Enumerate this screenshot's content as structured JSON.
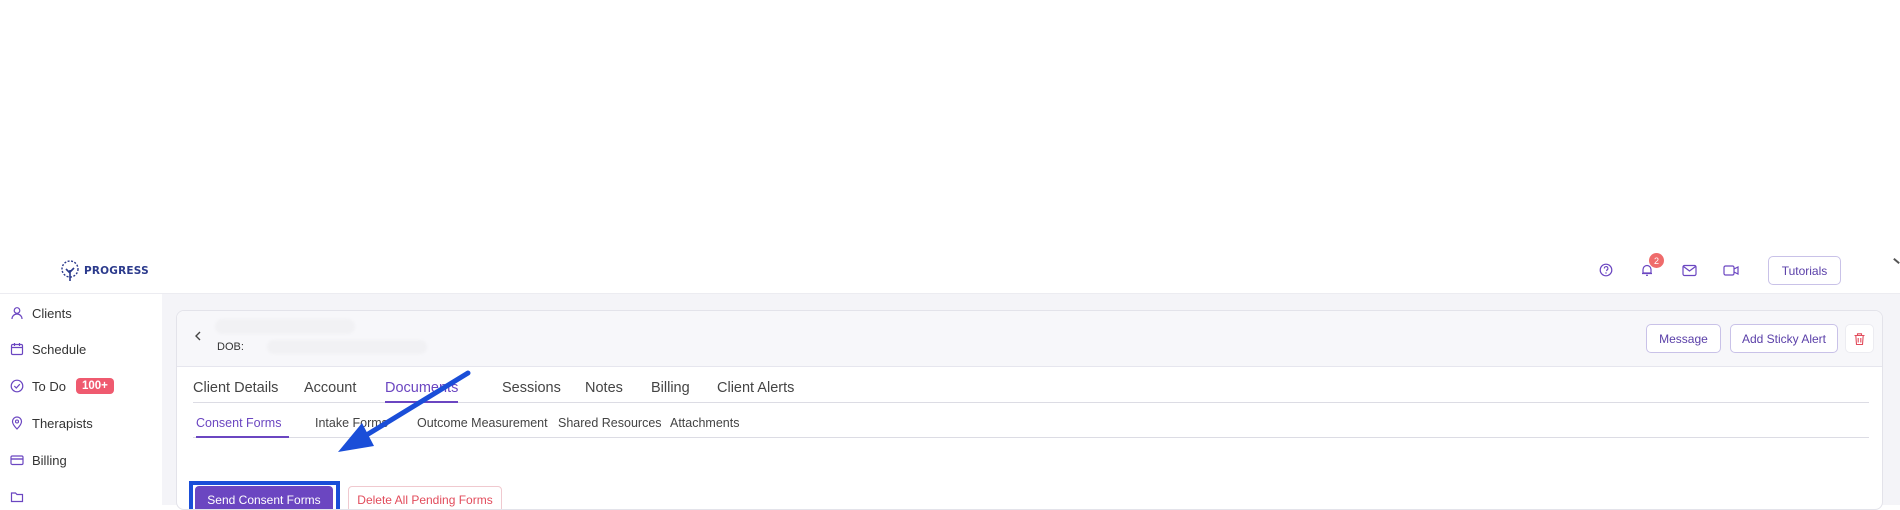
{
  "app": {
    "logo_text": "PROGRESS"
  },
  "topbar": {
    "icons": [
      "help-icon",
      "bell-icon",
      "mail-icon",
      "video-icon"
    ],
    "notification_count": "2",
    "tutorials_label": "Tutorials"
  },
  "sidebar": {
    "items": [
      {
        "label": "Clients",
        "icon": "user-icon"
      },
      {
        "label": "Schedule",
        "icon": "calendar-icon"
      },
      {
        "label": "To Do",
        "icon": "check-circle-icon",
        "badge": "100+"
      },
      {
        "label": "Therapists",
        "icon": "location-pin-icon"
      },
      {
        "label": "Billing",
        "icon": "credit-card-icon"
      }
    ]
  },
  "client": {
    "dob_label": "DOB:",
    "message_label": "Message",
    "sticky_alert_label": "Add Sticky Alert"
  },
  "tabs": [
    "Client Details",
    "Account",
    "Documents",
    "Sessions",
    "Notes",
    "Billing",
    "Client Alerts"
  ],
  "active_tab": "Documents",
  "subtabs": [
    "Consent Forms",
    "Intake Forms",
    "Outcome Measurement",
    "Shared Resources",
    "Attachments"
  ],
  "active_subtab": "Consent Forms",
  "actions": {
    "send_label": "Send Consent Forms",
    "delete_label": "Delete All Pending Forms"
  },
  "colors": {
    "accent": "#6b46c1",
    "danger": "#e24b5b",
    "highlight": "#1a4ed8",
    "badge": "#ef5a6f"
  }
}
